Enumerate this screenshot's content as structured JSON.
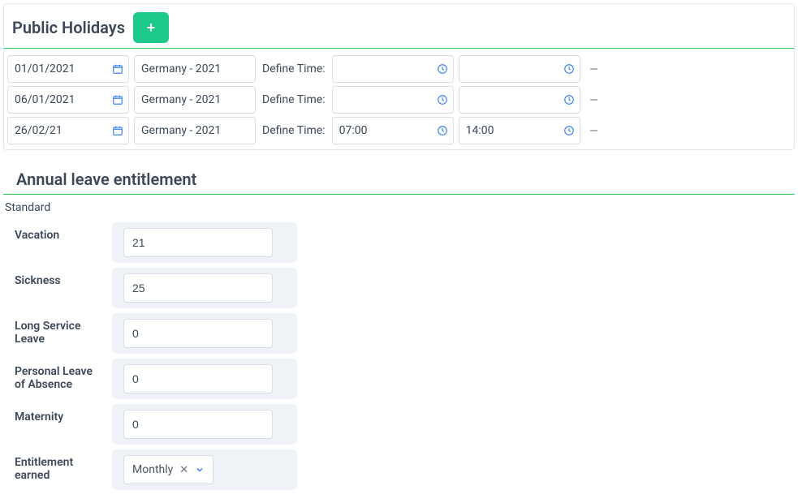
{
  "holidays": {
    "title": "Public Holidays",
    "add_icon": "+",
    "define_time_label": "Define Time:",
    "dash": "–",
    "rows": [
      {
        "date": "01/01/2021",
        "name": "Germany - 2021",
        "time_from": "",
        "time_to": ""
      },
      {
        "date": "06/01/2021",
        "name": "Germany - 2021",
        "time_from": "",
        "time_to": ""
      },
      {
        "date": "26/02/21",
        "name": "Germany - 2021",
        "time_from": "07:00",
        "time_to": "14:00"
      }
    ]
  },
  "entitlement": {
    "title": "Annual leave entitlement",
    "standard_label": "Standard",
    "fields": {
      "vacation_label": "Vacation",
      "vacation_value": "21",
      "sickness_label": "Sickness",
      "sickness_value": "25",
      "long_service_label": "Long Service Leave",
      "long_service_value": "0",
      "personal_leave_label": "Personal Leave of Absence",
      "personal_leave_value": "0",
      "maternity_label": "Maternity",
      "maternity_value": "0",
      "earned_label": "Entitlement earned",
      "earned_value": "Monthly"
    }
  }
}
